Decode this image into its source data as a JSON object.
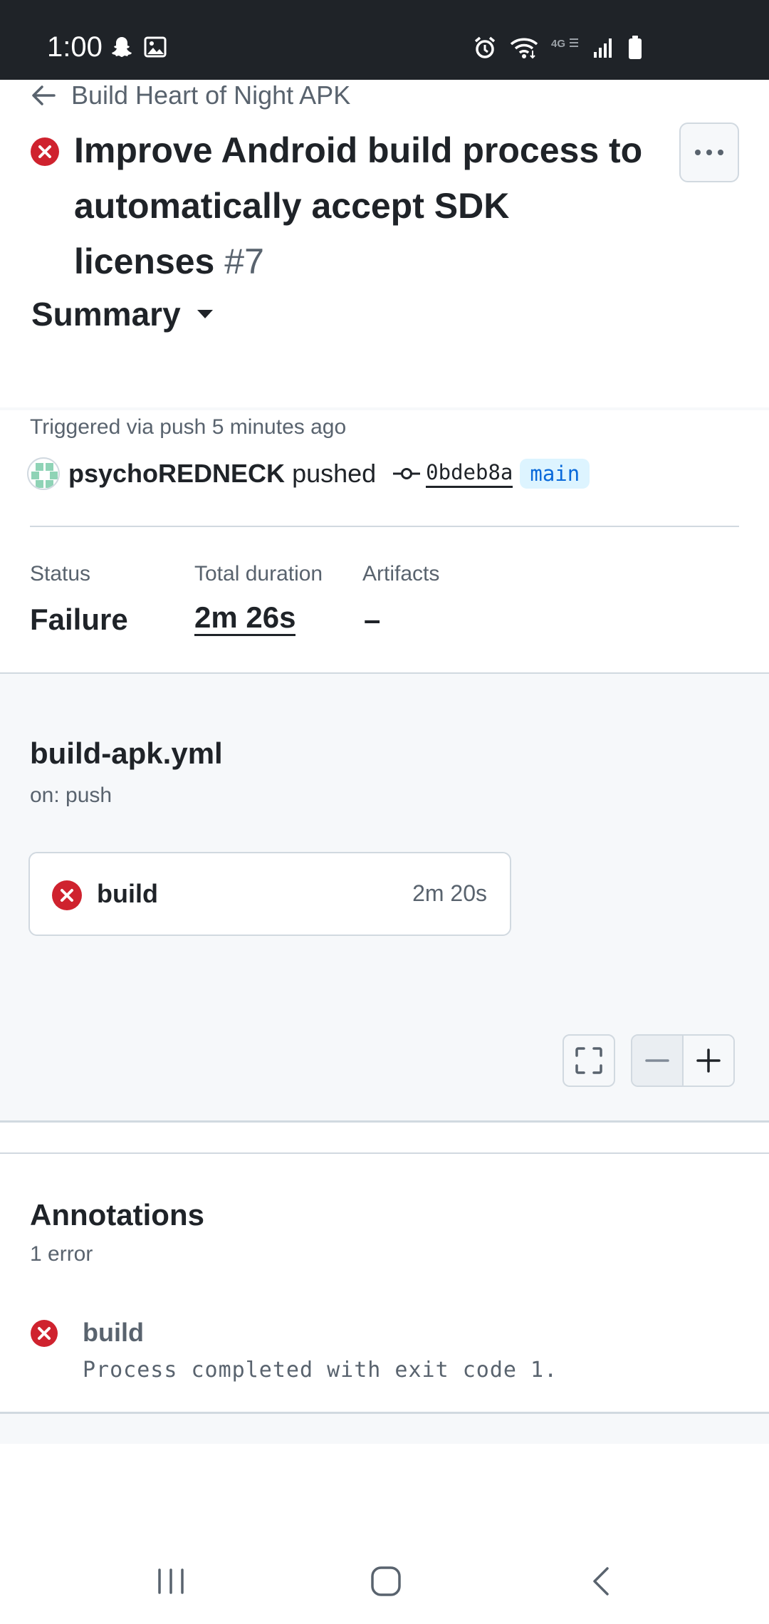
{
  "status_bar": {
    "time": "1:00",
    "left_icons": [
      "snapchat-icon",
      "image-icon"
    ],
    "right_icons": [
      "alarm-icon",
      "wifi-icon",
      "lte-icon",
      "signal-icon",
      "battery-icon"
    ],
    "network_label": "4G"
  },
  "header": {
    "back_label": "Build Heart of Night APK",
    "title": "Improve Android build process to automatically accept SDK licenses",
    "run_number": "#7",
    "status_icon": "x-circle-fill-icon",
    "menu_icon": "kebab-horizontal-icon"
  },
  "summary": {
    "label": "Summary"
  },
  "trigger": {
    "text": "Triggered via push 5 minutes ago",
    "user": "psychoREDNECK",
    "action": "pushed",
    "commit_sha": "0bdeb8a",
    "branch": "main"
  },
  "meta": {
    "status_label": "Status",
    "status_value": "Failure",
    "duration_label": "Total duration",
    "duration_value": "2m 26s",
    "artifacts_label": "Artifacts",
    "artifacts_value": "–"
  },
  "workflow": {
    "file": "build-apk.yml",
    "trigger": "on: push",
    "jobs": [
      {
        "name": "build",
        "duration": "2m 20s",
        "status": "failure"
      }
    ]
  },
  "annotations": {
    "title": "Annotations",
    "count": "1 error",
    "items": [
      {
        "job": "build",
        "message": "Process completed with exit code 1."
      }
    ]
  },
  "colors": {
    "danger": "#cf222e",
    "accent": "#0969da",
    "muted": "#59636e",
    "border": "#d1d9e0",
    "canvas_subtle": "#f6f8fa"
  }
}
